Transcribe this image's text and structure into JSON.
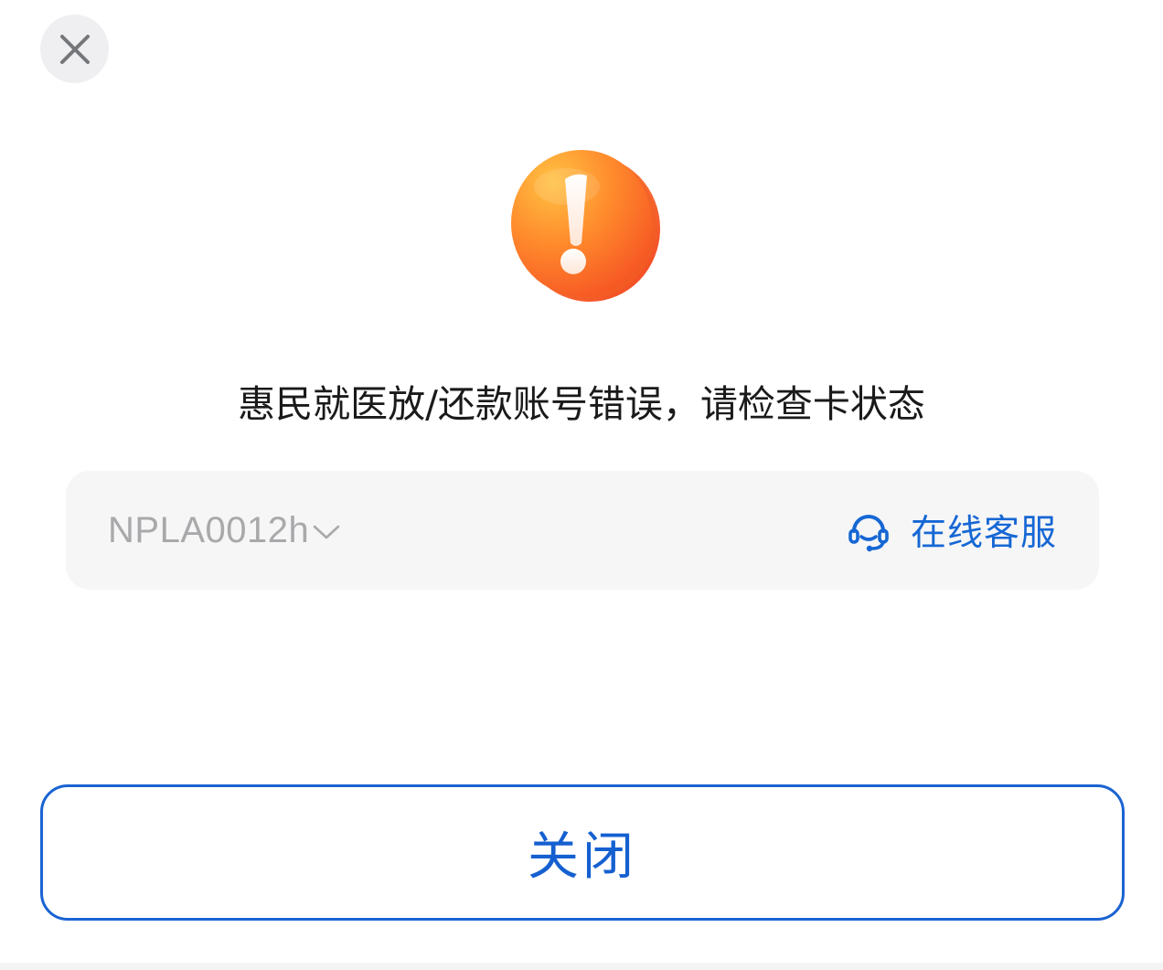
{
  "dialog": {
    "close_icon": "close-icon",
    "illustration_icon": "exclamation-icon",
    "message": "惠民就医放/还款账号错误，请检查卡状态",
    "account": {
      "value": "NPLA0012h",
      "dropdown_icon": "chevron-down-icon"
    },
    "support": {
      "icon": "headset-icon",
      "label": "在线客服"
    },
    "close_button_label": "关闭"
  },
  "colors": {
    "accent": "#1667d4",
    "message_text": "#1a1a1a",
    "muted_text": "#a9a9ab",
    "card_background": "#f6f6f7",
    "warning_orange": "#ff6a1f"
  }
}
